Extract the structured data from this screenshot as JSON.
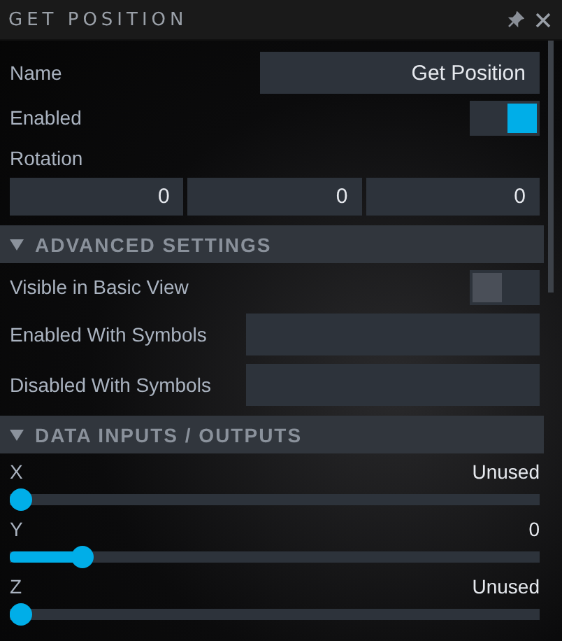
{
  "window": {
    "title": "GET POSITION"
  },
  "fields": [
    {
      "kind": "text",
      "label": "Name",
      "value": "Get Position"
    },
    {
      "kind": "toggle",
      "label": "Enabled",
      "on": true
    },
    {
      "kind": "vector",
      "label": "Rotation",
      "values": [
        "0",
        "0",
        "0"
      ]
    }
  ],
  "sections": [
    {
      "title": "ADVANCED SETTINGS",
      "expanded": true,
      "fields": [
        {
          "kind": "toggle",
          "label": "Visible in Basic View",
          "on": false
        },
        {
          "kind": "text",
          "label": "Enabled With Symbols"
        },
        {
          "kind": "text",
          "label": "Disabled With Symbols"
        }
      ]
    },
    {
      "title": "DATA INPUTS / OUTPUTS",
      "expanded": true,
      "fields": [
        {
          "kind": "slider",
          "label": "X",
          "reading": "Unused",
          "level": 0
        },
        {
          "kind": "slider",
          "label": "Y",
          "reading": "0",
          "level": 0.12
        },
        {
          "kind": "slider",
          "label": "Z",
          "reading": "Unused",
          "level": 0
        }
      ]
    }
  ]
}
